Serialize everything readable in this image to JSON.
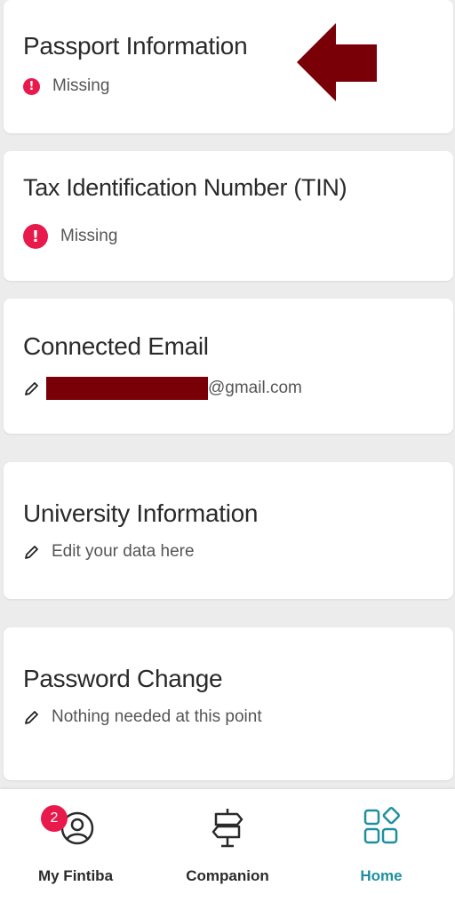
{
  "cards": {
    "passport": {
      "title": "Passport Information",
      "status": "Missing"
    },
    "tin": {
      "title": "Tax Identification Number (TIN)",
      "status": "Missing"
    },
    "email": {
      "title": "Connected Email",
      "email_suffix": "@gmail.com"
    },
    "university": {
      "title": "University Information",
      "subtitle": "Edit your data here"
    },
    "password": {
      "title": "Password Change",
      "subtitle": "Nothing needed at this point"
    }
  },
  "icons": {
    "alert": "exclamation-circle-icon",
    "edit": "pencil-icon",
    "annotation": "left-arrow-icon"
  },
  "nav": {
    "items": [
      {
        "label": "My Fintiba",
        "icon": "profile-icon",
        "badge": "2"
      },
      {
        "label": "Companion",
        "icon": "signpost-icon"
      },
      {
        "label": "Home",
        "icon": "home-grid-icon",
        "active": true
      }
    ]
  },
  "colors": {
    "alert": "#e8194b",
    "redaction": "#7a0008",
    "arrow": "#7a0008",
    "active_nav": "#1f8f9e",
    "background": "#ececec"
  }
}
